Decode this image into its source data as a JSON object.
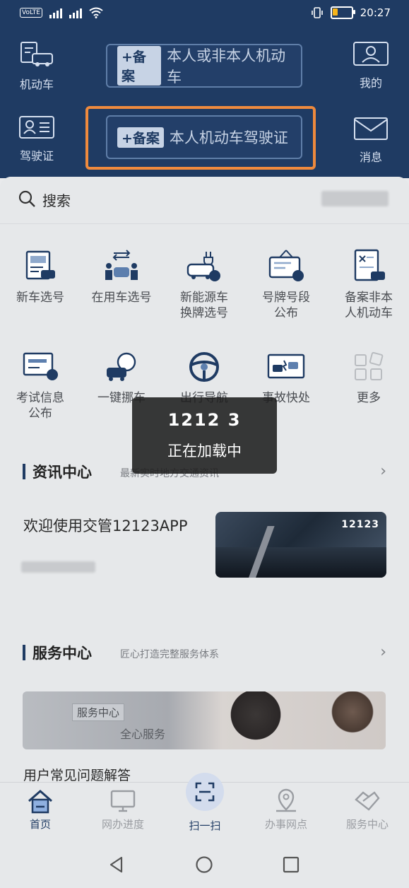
{
  "status": {
    "time": "20:27",
    "volte": "VoLTE"
  },
  "header": {
    "left_top_label": "机动车",
    "left_bottom_label": "驾驶证",
    "right_top_label": "我的",
    "right_bottom_label": "消息",
    "pill_top": {
      "tag": "+备案",
      "text": "本人或非本人机动车"
    },
    "pill_bottom": {
      "tag": "+备案",
      "text": "本人机动车驾驶证"
    }
  },
  "search": {
    "label": "搜索"
  },
  "grid": [
    {
      "line1": "新车选号",
      "line2": ""
    },
    {
      "line1": "在用车选号",
      "line2": ""
    },
    {
      "line1": "新能源车",
      "line2": "换牌选号"
    },
    {
      "line1": "号牌号段",
      "line2": "公布"
    },
    {
      "line1": "备案非本",
      "line2": "人机动车"
    },
    {
      "line1": "考试信息",
      "line2": "公布"
    },
    {
      "line1": "一键挪车",
      "line2": ""
    },
    {
      "line1": "出行导航",
      "line2": ""
    },
    {
      "line1": "事故快处",
      "line2": ""
    },
    {
      "line1": "更多",
      "line2": ""
    }
  ],
  "toast": {
    "title": "1212 3",
    "message": "正在加载中"
  },
  "news": {
    "title": "资讯中心",
    "subtitle": "最新实时地方交通资讯",
    "headline": "欢迎使用交管12123APP",
    "image_badge": "12123"
  },
  "service": {
    "title": "服务中心",
    "subtitle": "匠心打造完整服务体系",
    "banner_tag": "服务中心",
    "banner_text": "全心服务",
    "faq": "用户常见问题解答"
  },
  "tabs": [
    {
      "label": "首页"
    },
    {
      "label": "网办进度"
    },
    {
      "label": "扫一扫"
    },
    {
      "label": "办事网点"
    },
    {
      "label": "服务中心"
    }
  ],
  "colors": {
    "header_bg": "#1f3b63",
    "highlight": "#ef8a3d",
    "accent": "#1f3b63"
  }
}
